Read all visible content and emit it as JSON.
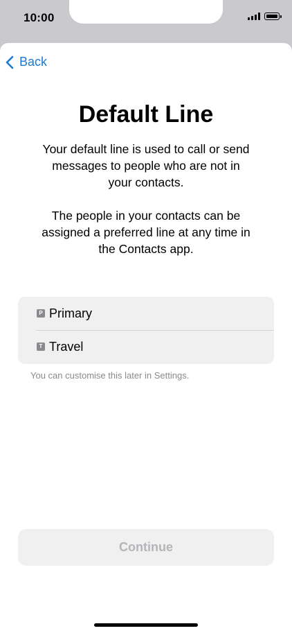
{
  "status_bar": {
    "time": "10:00",
    "signal_icon": "cellular-signal-icon",
    "battery_icon": "battery-icon"
  },
  "nav": {
    "back_label": "Back",
    "back_icon": "chevron-left-icon"
  },
  "main": {
    "title": "Default Line",
    "description_1": "Your default line is used to call or send messages to people who are not in your contacts.",
    "description_2": "The people in your contacts can be assigned a preferred line at any time in the Contacts app."
  },
  "lines": [
    {
      "badge": "P",
      "label": "Primary"
    },
    {
      "badge": "T",
      "label": "Travel"
    }
  ],
  "footnote": "You can customise this later in Settings.",
  "continue_label": "Continue",
  "colors": {
    "accent": "#1a7ad6",
    "disabled_text": "#b5b5b9",
    "group_background": "#f0f0f1"
  }
}
